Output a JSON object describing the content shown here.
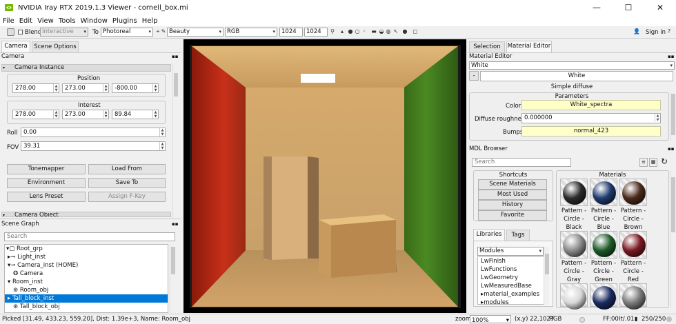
{
  "window": {
    "title": "NVIDIA Iray RTX 2019.1.3 Viewer - cornell_box.mi",
    "min": "—",
    "max": "☐",
    "close": "✕"
  },
  "menu": [
    "File",
    "Edit",
    "View",
    "Tools",
    "Window",
    "Plugins",
    "Help"
  ],
  "toolbar": {
    "blend_label": "Blend",
    "blend_mode": "Interactive",
    "to_label": "To",
    "target": "Photoreal",
    "canvas": "Beauty",
    "format": "RGB",
    "width": "1024",
    "height": "1024",
    "sign_in": "Sign in"
  },
  "left": {
    "tabs": [
      "Camera",
      "Scene Options"
    ],
    "camera_header": "Camera",
    "instance_header": "Camera Instance",
    "position_label": "Position",
    "position": [
      "278.00",
      "273.00",
      "-800.00"
    ],
    "interest_label": "Interest",
    "interest": [
      "278.00",
      "273.00",
      "89.84"
    ],
    "roll_label": "Roll",
    "roll": "0.00",
    "fov_label": "FOV",
    "fov": "39.31",
    "buttons": [
      "Tonemapper",
      "Load From",
      "Environment",
      "Save To",
      "Lens Preset",
      "Assign F-Key"
    ],
    "object_header": "Camera Object"
  },
  "scene_graph": {
    "header": "Scene Graph",
    "search_placeholder": "Search",
    "items": [
      {
        "label": "Root_grp",
        "selected": false
      },
      {
        "label": "Light_inst",
        "selected": false
      },
      {
        "label": "Camera_inst (HOME)",
        "selected": false
      },
      {
        "label": "Camera",
        "selected": false
      },
      {
        "label": "Room_inst",
        "selected": false
      },
      {
        "label": "Room_obj",
        "selected": false
      },
      {
        "label": "Tall_block_inst",
        "selected": true
      },
      {
        "label": "Tall_block_obj",
        "selected": false
      }
    ]
  },
  "right": {
    "tabs": [
      "Selection",
      "Material Editor"
    ],
    "editor_header": "Material Editor",
    "material_combo": "White",
    "material_name": "White",
    "material_type": "Simple diffuse",
    "parameters_label": "Parameters",
    "color_label": "Color",
    "color_value": "White_spectra",
    "roughness_label": "Diffuse roughness",
    "roughness_value": "0.000000",
    "bumps_label": "Bumps",
    "bumps_value": "normal_423",
    "browser_header": "MDL Browser",
    "browser_search": "Search",
    "shortcuts_label": "Shortcuts",
    "shortcuts": [
      "Scene Materials",
      "Most Used",
      "History",
      "Favorite"
    ],
    "lib_tabs": [
      "Libraries",
      "Tags"
    ],
    "modules_label": "Modules",
    "modules": [
      "LwFinish",
      "LwFunctions",
      "LwGeometry",
      "LwMeasuredBase",
      "material_examples",
      "modules"
    ],
    "materials_label": "Materials",
    "materials": [
      {
        "name": "Pattern - Circle - Black",
        "color": "#2b2b2b"
      },
      {
        "name": "Pattern - Circle - Blue",
        "color": "#1e3a6e"
      },
      {
        "name": "Pattern - Circle - Brown",
        "color": "#4a2a1c"
      },
      {
        "name": "Pattern - Circle - Gray",
        "color": "#8a8a8a"
      },
      {
        "name": "Pattern - Circle - Green",
        "color": "#1e5a2a"
      },
      {
        "name": "Pattern - Circle - Red",
        "color": "#7a1a22"
      },
      {
        "name": "",
        "color": "#d8d8d8"
      },
      {
        "name": "",
        "color": "#1a2a60"
      },
      {
        "name": "",
        "color": "#7a7a7a"
      }
    ]
  },
  "status": {
    "picked": "Picked [31.49, 433.23, 559.20], Dist: 1.39e+3, Name: Room_obj",
    "zoom_label": "zoom",
    "zoom": "100%",
    "coords": "(x,y) 22,1027",
    "rgb": "RGB",
    "ff": "FF:",
    "ff_value": "00",
    "it_label": "It/",
    "it_value": ".01",
    "frames": "250/250"
  },
  "colors": {
    "accent": "#0078d7",
    "yellow_field": "#ffffc8"
  }
}
